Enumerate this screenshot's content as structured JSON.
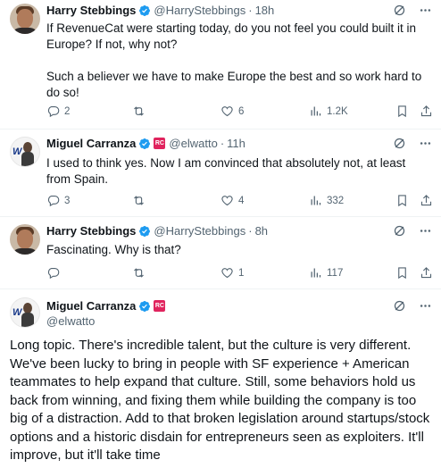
{
  "colors": {
    "accent": "#1d9bf0",
    "muted": "#536471",
    "text": "#0f1419",
    "badge": "#e0245e"
  },
  "icons": {
    "verified": "verified-badge-icon",
    "grok": "grok-icon",
    "more": "more-icon",
    "reply": "reply-icon",
    "retweet": "retweet-icon",
    "like": "like-icon",
    "views": "views-icon",
    "bookmark": "bookmark-icon",
    "share": "share-icon"
  },
  "tweets": [
    {
      "name": "Harry Stebbings",
      "handle": "@HarryStebbings",
      "dot": "·",
      "time": "18h",
      "text": "If RevenueCat were starting today, do you not feel you could built it in Europe? If not, why not?\n\nSuch a believer we have to make Europe the best and so work hard to do so!",
      "replies": "2",
      "retweets": "",
      "likes": "6",
      "views": "1.2K"
    },
    {
      "name": "Miguel Carranza",
      "badge": "RC",
      "handle": "@elwatto",
      "dot": "·",
      "time": "11h",
      "text": "I used to think yes. Now I am convinced that absolutely not, at least from Spain.",
      "replies": "3",
      "retweets": "",
      "likes": "4",
      "views": "332"
    },
    {
      "name": "Harry Stebbings",
      "handle": "@HarryStebbings",
      "dot": "·",
      "time": "8h",
      "text": "Fascinating. Why is that?",
      "replies": "",
      "retweets": "",
      "likes": "1",
      "views": "117"
    }
  ],
  "main": {
    "name": "Miguel Carranza",
    "badge": "RC",
    "handle": "@elwatto",
    "text": "Long topic. There's incredible talent, but the culture is very different. We've been lucky to bring in people with SF experience + American teammates to help expand that culture. Still, some behaviors hold us back from winning, and fixing them while building the company is too big of a distraction. Add to that broken legislation around startups/stock options and a historic disdain for entrepreneurs seen as exploiters. It'll improve, but it'll take time"
  }
}
